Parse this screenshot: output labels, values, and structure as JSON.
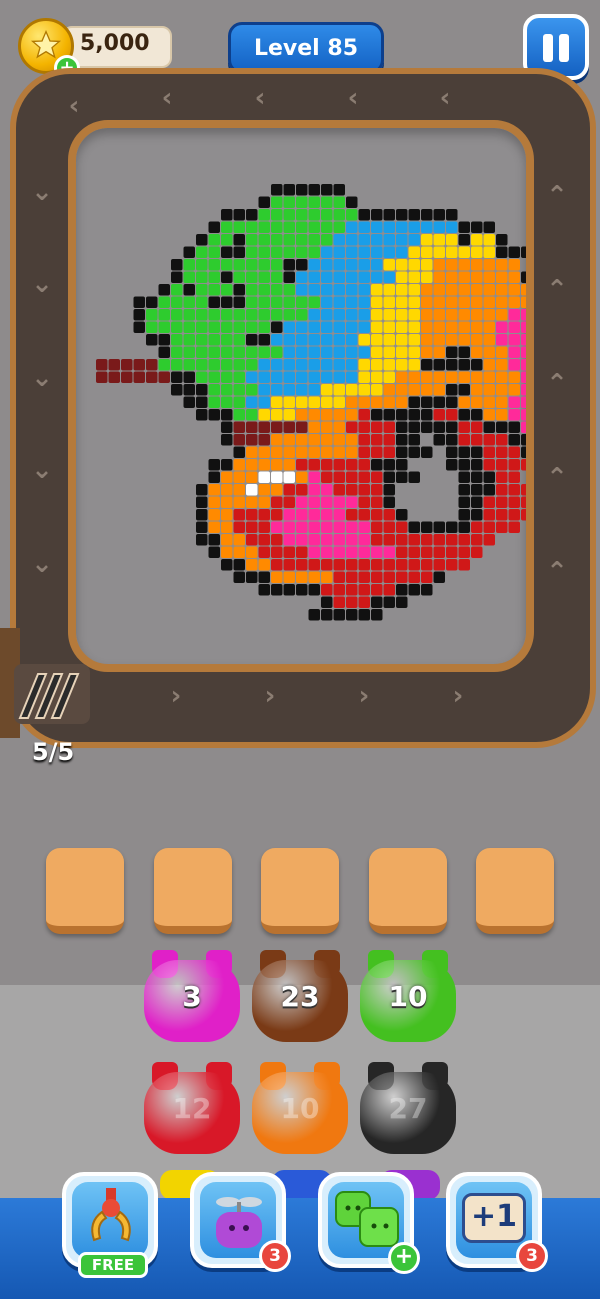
{
  "hud": {
    "coins": "5,000",
    "level_label": "Level 85"
  },
  "colors": {
    "track_wood": "#b57a3b",
    "track_belt": "#4b3f38",
    "slot": "#efaa61",
    "bottom_bar": "#1f6cc8",
    "jelly_magenta": "#e020c8",
    "jelly_brown": "#7a3a16",
    "jelly_green": "#44c020",
    "jelly_red": "#d81828",
    "jelly_orange": "#f07810",
    "jelly_black": "#262626"
  },
  "launcher": {
    "count": "5/5"
  },
  "slots": [
    "",
    "",
    "",
    "",
    ""
  ],
  "jellies": [
    {
      "color": "#e020c8",
      "count": "3"
    },
    {
      "color": "#7a3a16",
      "count": "23"
    },
    {
      "color": "#44c020",
      "count": "10"
    },
    {
      "color": "#d81828",
      "count": "12"
    },
    {
      "color": "#f07810",
      "count": "10"
    },
    {
      "color": "#262626",
      "count": "27"
    }
  ],
  "boosters": [
    {
      "icon": "claw-icon",
      "badge": "FREE"
    },
    {
      "icon": "propeller-jelly-icon",
      "badge": "3"
    },
    {
      "icon": "green-jelly-icon",
      "badge": "+"
    },
    {
      "icon": "plus-one-icon",
      "label": "+1",
      "badge": "3"
    }
  ],
  "pixel_art": {
    "subject": "chameleon",
    "palette": [
      "#2ecc2e",
      "#1a9ee8",
      "#ffd800",
      "#ff8a00",
      "#ff2a9a",
      "#d01818",
      "#111111",
      "#7a1a1a",
      "#ffffff"
    ]
  }
}
